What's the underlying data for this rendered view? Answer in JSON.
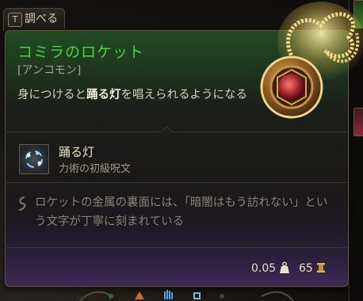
{
  "header": {
    "examine_key": "T",
    "examine_label": "調べる"
  },
  "item": {
    "name": "コミラのロケット",
    "rarity": "[アンコモン]",
    "description_pre": "身につけると",
    "description_highlight": "踊る灯",
    "description_post": "を唱えられるようになる",
    "name_color": "#47d24c"
  },
  "spell": {
    "name": "踊る灯",
    "subtitle": "力術の初級呪文",
    "icon": "dancing-lights-icon"
  },
  "flavor": {
    "text": "ロケットの金属の裏面には、「暗闇はもう訪れない」という文字が丁寧に刻まれている",
    "icon": "scroll-quote-icon"
  },
  "stats": {
    "weight": "0.05",
    "weight_icon": "weight-icon",
    "price": "65",
    "price_icon": "gold-coin-icon"
  }
}
